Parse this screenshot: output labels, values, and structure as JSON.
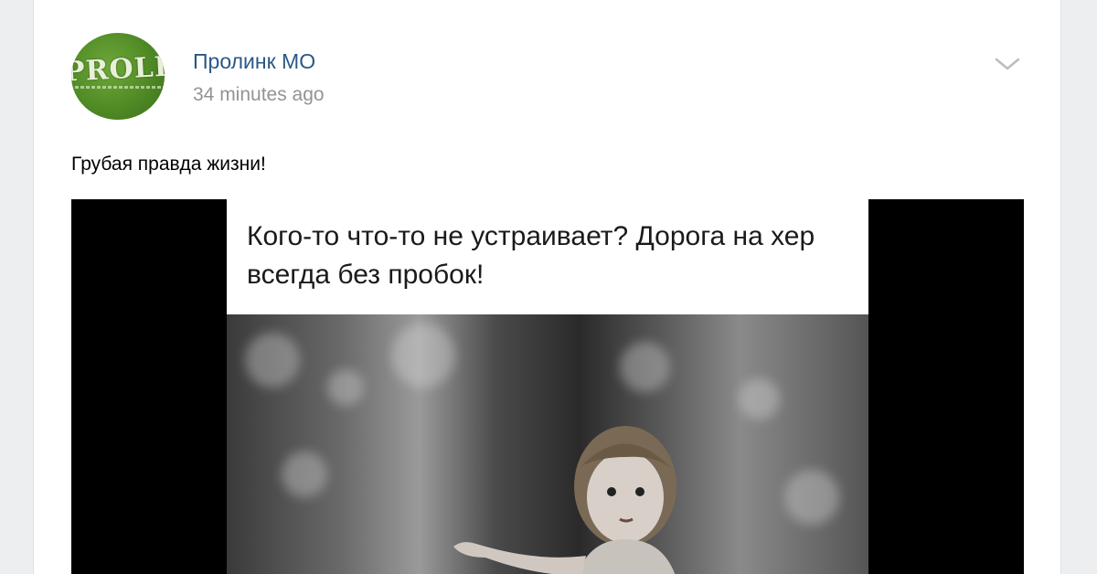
{
  "post": {
    "author": "Пролинк МО",
    "time": "34 minutes ago",
    "text": "Грубая правда жизни!",
    "avatar_text": "PROLIN",
    "meme_caption": "Кого-то что-то не устраивает? Дорога на хер всегда без пробок!"
  },
  "icons": {
    "menu": "chevron-down-icon"
  },
  "colors": {
    "link": "#2a5885",
    "accent": "#5181b8",
    "muted": "#939393",
    "page_bg": "#edeef0"
  }
}
